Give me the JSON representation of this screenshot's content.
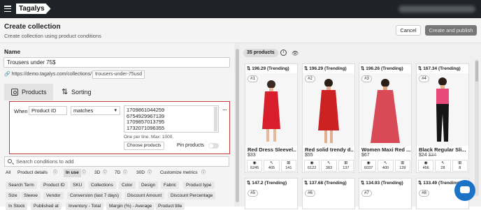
{
  "app": {
    "logo": "Tagalys"
  },
  "header": {
    "title": "Create collection",
    "subtitle": "Create collection using product conditions",
    "cancel_label": "Cancel",
    "publish_label": "Create and publish"
  },
  "form": {
    "name_label": "Name",
    "name_value": "Trousers under 75$",
    "url_prefix": "https://demo.tagalys.com/collections/",
    "url_slug": "trousers-under-75usd"
  },
  "tabs": [
    {
      "label": "Products",
      "active": true
    },
    {
      "label": "Sorting",
      "active": false
    }
  ],
  "condition": {
    "when_label": "When",
    "field": "Product ID",
    "operator": "matches",
    "values": [
      "1709861044259",
      "6754929967139",
      "1709857013795",
      "1732071096355"
    ],
    "hint": "One per line. Max: 1000.",
    "choose_label": "Choose products",
    "pin_label": "Pin products",
    "pin_enabled": false
  },
  "search": {
    "placeholder": "Search conditions to add"
  },
  "filters": {
    "all": "All",
    "details": "Product details",
    "inuse": "In use",
    "d3": "3D",
    "d7": "7D",
    "d30": "30D",
    "custom": "Customize metrics"
  },
  "chips": [
    "Search Term",
    "Product ID",
    "SKU",
    "Collections",
    "Color",
    "Design",
    "Fabric",
    "Product type",
    "Size",
    "Sleeve",
    "Vendor",
    "Conversion (last 7 days)",
    "Discount Amount",
    "Discount Percentage",
    "In Stock",
    "Published at",
    "Inventory - Total",
    "Margin (%) - Average",
    "Product title"
  ],
  "results": {
    "count_label": "35 products"
  },
  "products": [
    {
      "rank": "196.29 (Trending)",
      "pos": "#1",
      "name": "Red Dress Sleevel...",
      "price": "$33",
      "old_price": "",
      "views": "6245",
      "clicks": "405",
      "carts": "141",
      "accent": "#d81e2a"
    },
    {
      "rank": "196.29 (Trending)",
      "pos": "#2",
      "name": "Red solid trendy d...",
      "price": "$55",
      "old_price": "",
      "views": "6122",
      "clicks": "383",
      "carts": "137",
      "accent": "#cc2222"
    },
    {
      "rank": "196.26 (Trending)",
      "pos": "#3",
      "name": "Women Maxi Red ...",
      "price": "$67",
      "old_price": "",
      "views": "6037",
      "clicks": "400",
      "carts": "139",
      "accent": "#d94a57"
    },
    {
      "rank": "167.34 (Trending)",
      "pos": "#4",
      "name": "Black Regular Sli...",
      "price": "$24",
      "old_price": "$34",
      "views": "456",
      "clicks": "28",
      "carts": "8",
      "accent": "#151515"
    }
  ],
  "products_row2": [
    {
      "rank": "147.2 (Trending)",
      "pos": "#5"
    },
    {
      "rank": "137.68 (Trending)",
      "pos": "#6"
    },
    {
      "rank": "134.93 (Trending)",
      "pos": "#7"
    },
    {
      "rank": "133.49 (Trending)",
      "pos": "#8"
    }
  ]
}
